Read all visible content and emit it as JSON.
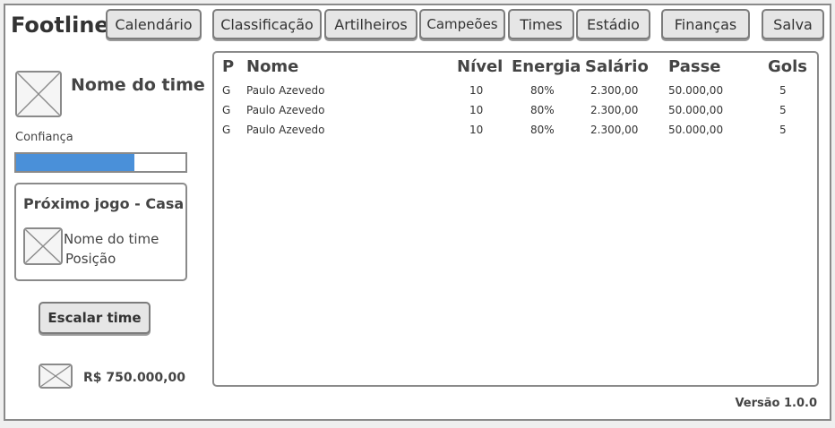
{
  "app": {
    "title": "Footline",
    "version": "Versão 1.0.0"
  },
  "nav": [
    "Calendário",
    "Classificação",
    "Artilheiros",
    "Campeões",
    "Times",
    "Estádio",
    "Finanças",
    "Salva"
  ],
  "team": {
    "name": "Nome do time",
    "confidence_label": "Confiança",
    "confidence": 0.7
  },
  "next_game": {
    "title": "Próximo jogo - Casa",
    "opponent_name": "Nome do time",
    "opponent_position": "Posição"
  },
  "actions": {
    "escalar": "Escalar time"
  },
  "finance": {
    "balance": "R$ 750.000,00"
  },
  "table": {
    "columns": [
      "P",
      "Nome",
      "Nível",
      "Energia",
      "Salário",
      "Passe",
      "Gols"
    ],
    "rows": [
      [
        "G",
        "Paulo Azevedo",
        "10",
        "80%",
        "2.300,00",
        "50.000,00",
        "5"
      ],
      [
        "G",
        "Paulo Azevedo",
        "10",
        "80%",
        "2.300,00",
        "50.000,00",
        "5"
      ],
      [
        "G",
        "Paulo Azevedo",
        "10",
        "80%",
        "2.300,00",
        "50.000,00",
        "5"
      ]
    ]
  },
  "colors": {
    "accent": "#4a90d9",
    "border": "#8a8a8a",
    "button_bg": "#e6e6e6"
  }
}
